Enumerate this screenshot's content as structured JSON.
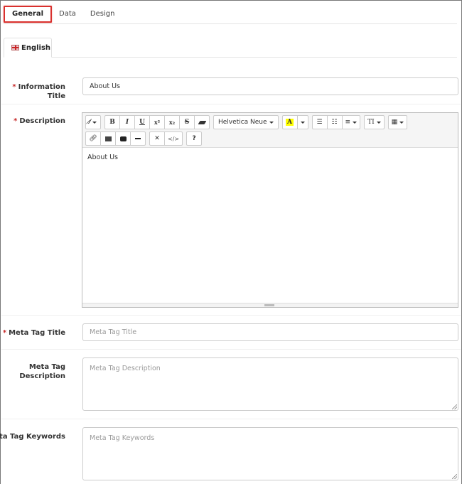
{
  "tabs": {
    "items": [
      {
        "label": "General",
        "active": true
      },
      {
        "label": "Data",
        "active": false
      },
      {
        "label": "Design",
        "active": false
      }
    ]
  },
  "language_tab": {
    "label": "English",
    "flag": "uk-flag-icon"
  },
  "fields": {
    "information_title": {
      "label": "Information Title",
      "required": true,
      "value": "About Us"
    },
    "description": {
      "label": "Description",
      "required": true,
      "content": "About Us",
      "toolbar": {
        "style": "magic-wand-icon",
        "bold": "B",
        "italic": "I",
        "underline": "U",
        "superscript": "x²",
        "subscript": "x₂",
        "strikethrough": "S",
        "eraser": "eraser-icon",
        "font_name": "Helvetica Neue",
        "color": "A",
        "unordered_list": "list-ul-icon",
        "ordered_list": "list-ol-icon",
        "align": "align-icon",
        "font_size": "TI",
        "table": "table-icon",
        "link": "link-icon",
        "picture": "picture-icon",
        "video": "video-icon",
        "hr": "hr-icon",
        "fullscreen": "fullscreen-icon",
        "codeview": "</>",
        "help": "?"
      }
    },
    "meta_title": {
      "label": "Meta Tag Title",
      "required": true,
      "value": "",
      "placeholder": "Meta Tag Title"
    },
    "meta_description": {
      "label_line1": "Meta Tag",
      "label_line2": "Description",
      "required": false,
      "value": "",
      "placeholder": "Meta Tag Description"
    },
    "meta_keywords": {
      "label": "Meta Tag Keywords",
      "required": false,
      "value": "",
      "placeholder": "Meta Tag Keywords"
    }
  },
  "colors": {
    "required": "#c62828",
    "active_tab_outline": "#d9302d",
    "highlight": "#ffff00"
  }
}
